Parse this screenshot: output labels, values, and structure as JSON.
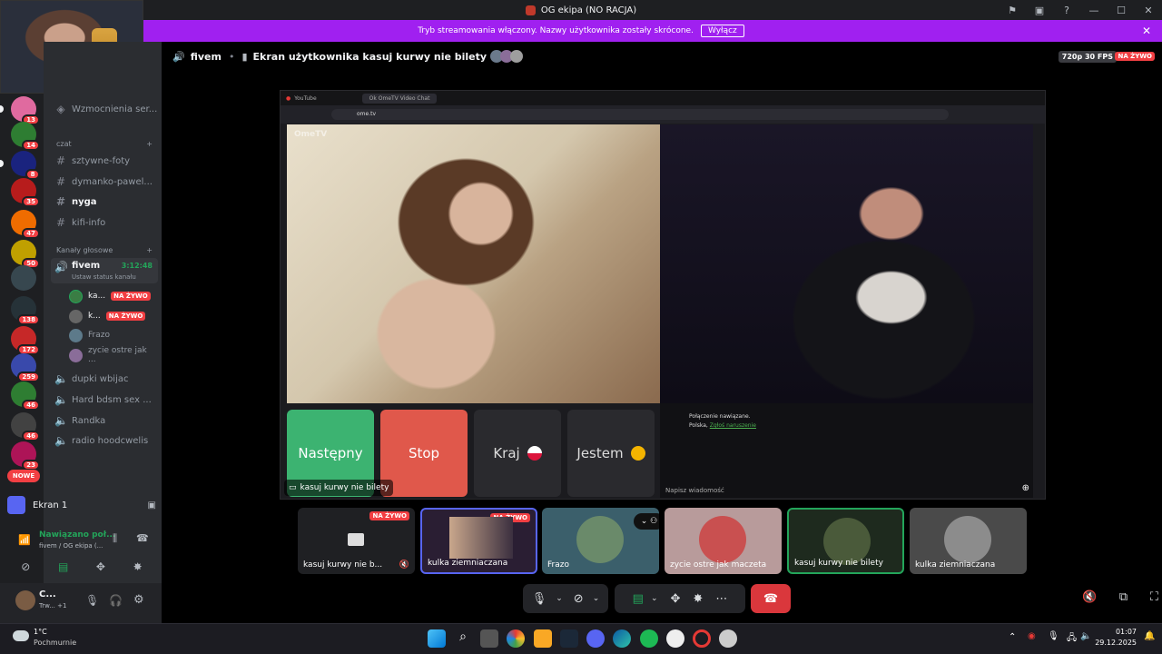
{
  "window": {
    "title": "OG ekipa (NO RACJA)"
  },
  "banner": {
    "text": "Tryb streamowania włączony. Nazwy użytkownika zostały skrócone.",
    "button": "Wyłącz"
  },
  "rail": {
    "badges": [
      "13",
      "14",
      "8",
      "35",
      "47",
      "50",
      "138",
      "172",
      "259",
      "46",
      "46",
      "23"
    ],
    "new_label": "NOWE"
  },
  "sidebar": {
    "boosts": "Wzmocnienia ser...",
    "text_category": "czat",
    "text_channels": [
      "sztywne-foty",
      "dymanko-pawel...",
      "nyga",
      "kifi-info"
    ],
    "voice_category": "Kanały głosowe",
    "active_voice": {
      "name": "fivem",
      "time": "3:12:48",
      "status": "Ustaw status kanału"
    },
    "voice_users": [
      {
        "name": "ka...",
        "live": "NA ŻYWO"
      },
      {
        "name": "k...",
        "live": "NA ŻYWO"
      },
      {
        "name": "Frazo",
        "live": ""
      },
      {
        "name": "zycie ostre jak ...",
        "live": ""
      }
    ],
    "voice_channels": [
      "dupki wbijac",
      "Hard bdsm sex ...",
      "Randka",
      "radio hoodcwelis"
    ]
  },
  "screen_panel": {
    "label": "Ekran 1"
  },
  "voice_panel": {
    "status": "Nawiązano poł...",
    "channel": "fivem / OG ekipa (..."
  },
  "user_panel": {
    "name": "C...",
    "status": "Trw... +1"
  },
  "stage": {
    "channel": "fivem",
    "title": "Ekran użytkownika kasuj kurwy nie bilety",
    "quality": "720p 30 FPS",
    "live": "NA ŻYWO"
  },
  "browser": {
    "tab1": "YouTube",
    "tab2": "Ok OmeTV Video Chat",
    "url": "ome.tv",
    "logo": "OmeTV",
    "buttons": {
      "next": "Następny",
      "stop": "Stop",
      "country": "Kraj",
      "gender": "Jestem"
    },
    "chat_line1": "Połączenie nawiązane.",
    "chat_line2_prefix": "Polska,",
    "chat_line2_link": "Zgłoś naruszenie",
    "chat_input": "Napisz wiadomość"
  },
  "share_label": "kasuj kurwy nie bilety",
  "tiles": [
    {
      "label": "kasuj kurwy nie b...",
      "live": "NA ŻYWO"
    },
    {
      "label": "kulka ziemniaczana",
      "live": "NA ŻYWO"
    },
    {
      "label": "Frazo",
      "live": ""
    },
    {
      "label": "zycie ostre jak maczeta",
      "live": ""
    },
    {
      "label": "kasuj kurwy nie bilety",
      "live": ""
    },
    {
      "label": "kulka ziemniaczana",
      "live": ""
    }
  ],
  "taskbar": {
    "weather_temp": "1°C",
    "weather_desc": "Pochmurnie",
    "time": "01:07",
    "date": "29.12.2025"
  },
  "colors": {
    "accent": "#a020f0",
    "live": "#f23f43",
    "next": "#3cb371",
    "stop": "#e0584b",
    "end_call": "#da373c"
  }
}
